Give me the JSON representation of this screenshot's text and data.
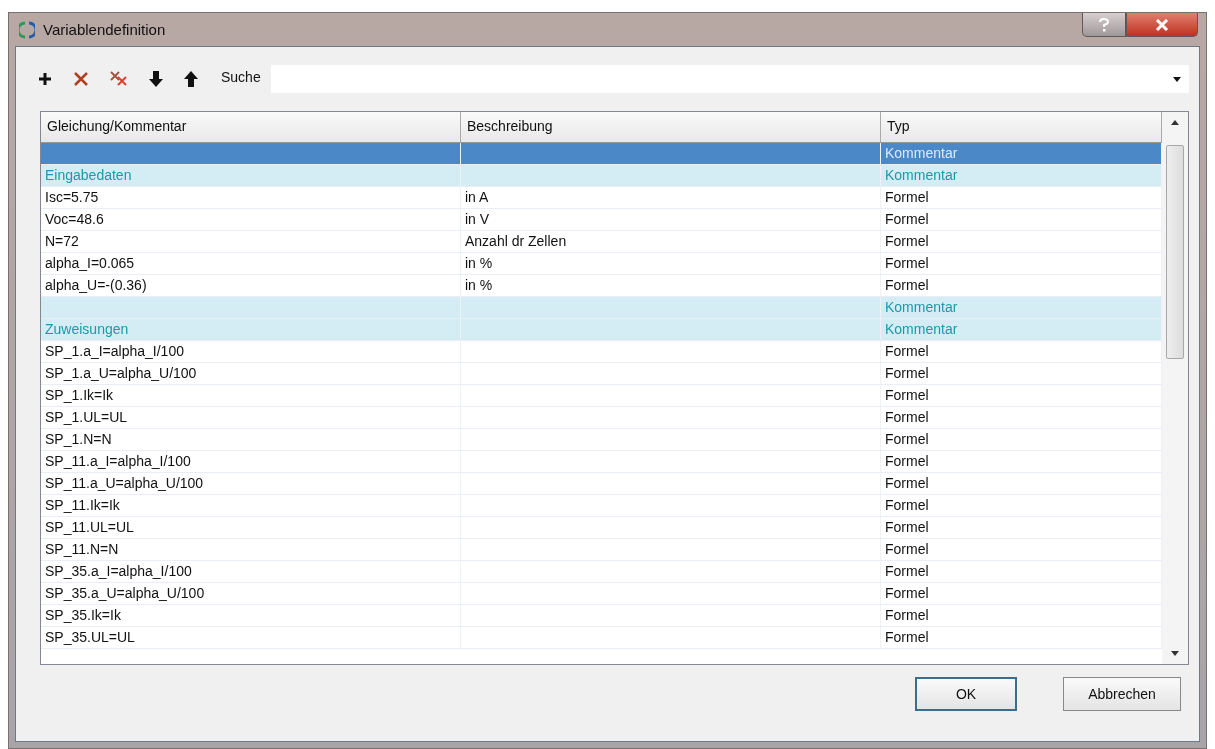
{
  "window": {
    "title": "Variablendefinition"
  },
  "toolbar": {
    "search_label": "Suche"
  },
  "table": {
    "columns": [
      "Gleichung/Kommentar",
      "Beschreibung",
      "Typ"
    ],
    "rows": [
      {
        "kind": "comment",
        "selected": true,
        "equation": "",
        "description": "",
        "type": "Kommentar"
      },
      {
        "kind": "comment",
        "selected": false,
        "equation": "Eingabedaten",
        "description": "",
        "type": "Kommentar"
      },
      {
        "kind": "formula",
        "selected": false,
        "equation": "Isc=5.75",
        "description": "in A",
        "type": "Formel"
      },
      {
        "kind": "formula",
        "selected": false,
        "equation": "Voc=48.6",
        "description": "in V",
        "type": "Formel"
      },
      {
        "kind": "formula",
        "selected": false,
        "equation": "N=72",
        "description": "Anzahl dr Zellen",
        "type": "Formel"
      },
      {
        "kind": "formula",
        "selected": false,
        "equation": "alpha_I=0.065",
        "description": "in %",
        "type": "Formel"
      },
      {
        "kind": "formula",
        "selected": false,
        "equation": "alpha_U=-(0.36)",
        "description": "in %",
        "type": "Formel"
      },
      {
        "kind": "comment",
        "selected": false,
        "equation": "",
        "description": "",
        "type": "Kommentar"
      },
      {
        "kind": "comment",
        "selected": false,
        "equation": "Zuweisungen",
        "description": "",
        "type": "Kommentar"
      },
      {
        "kind": "formula",
        "selected": false,
        "equation": "SP_1.a_I=alpha_I/100",
        "description": "",
        "type": "Formel"
      },
      {
        "kind": "formula",
        "selected": false,
        "equation": "SP_1.a_U=alpha_U/100",
        "description": "",
        "type": "Formel"
      },
      {
        "kind": "formula",
        "selected": false,
        "equation": "SP_1.Ik=Ik",
        "description": "",
        "type": "Formel"
      },
      {
        "kind": "formula",
        "selected": false,
        "equation": "SP_1.UL=UL",
        "description": "",
        "type": "Formel"
      },
      {
        "kind": "formula",
        "selected": false,
        "equation": "SP_1.N=N",
        "description": "",
        "type": "Formel"
      },
      {
        "kind": "formula",
        "selected": false,
        "equation": "SP_11.a_I=alpha_I/100",
        "description": "",
        "type": "Formel"
      },
      {
        "kind": "formula",
        "selected": false,
        "equation": "SP_11.a_U=alpha_U/100",
        "description": "",
        "type": "Formel"
      },
      {
        "kind": "formula",
        "selected": false,
        "equation": "SP_11.Ik=Ik",
        "description": "",
        "type": "Formel"
      },
      {
        "kind": "formula",
        "selected": false,
        "equation": "SP_11.UL=UL",
        "description": "",
        "type": "Formel"
      },
      {
        "kind": "formula",
        "selected": false,
        "equation": "SP_11.N=N",
        "description": "",
        "type": "Formel"
      },
      {
        "kind": "formula",
        "selected": false,
        "equation": "SP_35.a_I=alpha_I/100",
        "description": "",
        "type": "Formel"
      },
      {
        "kind": "formula",
        "selected": false,
        "equation": "SP_35.a_U=alpha_U/100",
        "description": "",
        "type": "Formel"
      },
      {
        "kind": "formula",
        "selected": false,
        "equation": "SP_35.Ik=Ik",
        "description": "",
        "type": "Formel"
      },
      {
        "kind": "formula",
        "selected": false,
        "equation": "SP_35.UL=UL",
        "description": "",
        "type": "Formel"
      }
    ]
  },
  "buttons": [
    {
      "label": "OK"
    },
    {
      "label": "Abbrechen"
    }
  ]
}
